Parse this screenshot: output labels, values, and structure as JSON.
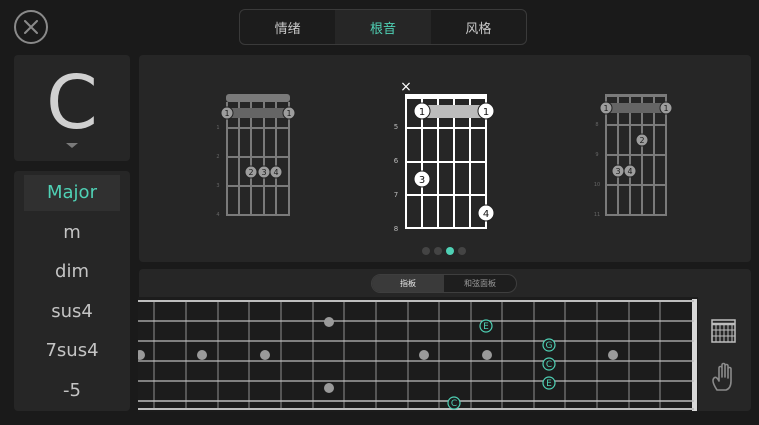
{
  "tabs": [
    {
      "label": "情绪",
      "active": false
    },
    {
      "label": "根音",
      "active": true
    },
    {
      "label": "风格",
      "active": false
    }
  ],
  "root_note": "C",
  "qualities": [
    {
      "label": "Major",
      "selected": true
    },
    {
      "label": "m",
      "selected": false
    },
    {
      "label": "dim",
      "selected": false
    },
    {
      "label": "sus4",
      "selected": false
    },
    {
      "label": "7sus4",
      "selected": false
    },
    {
      "label": "-5",
      "selected": false
    }
  ],
  "chord_diagrams": {
    "left": {
      "fret_labels": [
        "1",
        "2",
        "3",
        "4"
      ],
      "barre_labels": [
        "1",
        "1"
      ],
      "finger_labels": [
        "2",
        "3",
        "4"
      ]
    },
    "center": {
      "mute_symbol": "×",
      "fret_labels": [
        "5",
        "6",
        "7",
        "8"
      ],
      "barre_labels": [
        "1",
        "1"
      ],
      "finger_labels": [
        "3",
        "4"
      ]
    },
    "right": {
      "fret_labels": [
        "8",
        "9",
        "10",
        "11"
      ],
      "barre_labels": [
        "1",
        "1"
      ],
      "finger_labels": [
        "2",
        "3",
        "4"
      ]
    }
  },
  "pager": {
    "count": 4,
    "active_index": 2
  },
  "fretboard_view": {
    "options": [
      "指板",
      "和弦面板"
    ],
    "active": "指板"
  },
  "fretboard_notes": [
    "E",
    "G",
    "C",
    "E",
    "C"
  ],
  "colors": {
    "accent": "#4fd1b5",
    "background": "#1a1a1a",
    "panel": "#262626"
  },
  "icons": {
    "close": "close-icon",
    "grid": "chord-grid-icon",
    "hand": "hand-icon",
    "caret": "caret-down-icon"
  }
}
